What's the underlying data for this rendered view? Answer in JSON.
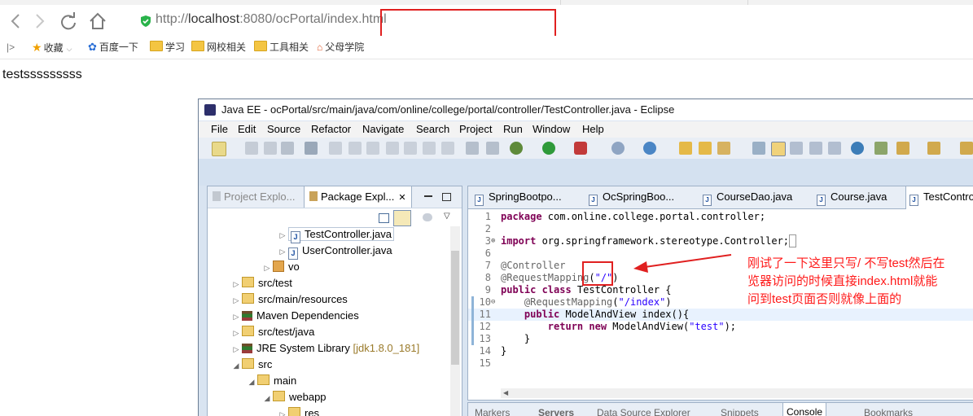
{
  "browser": {
    "url_scheme": "http://",
    "url_host": "localhost",
    "url_path": ":8080/ocPortal/index.html",
    "bookmarks": [
      {
        "label": "收藏",
        "icon": "star-icon"
      },
      {
        "label": "百度一下",
        "icon": "baidu-paw-icon"
      },
      {
        "label": "学习",
        "icon": "folder-icon"
      },
      {
        "label": "网校相关",
        "icon": "folder-icon"
      },
      {
        "label": "工具相关",
        "icon": "folder-icon"
      },
      {
        "label": "父母学院",
        "icon": "home-icon"
      }
    ]
  },
  "page": {
    "text": "testsssssssss"
  },
  "eclipse": {
    "title": "Java EE - ocPortal/src/main/java/com/online/college/portal/controller/TestController.java - Eclipse",
    "menu": [
      "File",
      "Edit",
      "Source",
      "Refactor",
      "Navigate",
      "Search",
      "Project",
      "Run",
      "Window",
      "Help"
    ],
    "left_tabs": [
      "Project Explo...",
      "Package Expl..."
    ],
    "tree": [
      {
        "label": "TestController.java",
        "type": "java",
        "selected": true
      },
      {
        "label": "UserController.java",
        "type": "java"
      },
      {
        "label": "vo",
        "type": "package"
      },
      {
        "label": "src/test",
        "type": "src-folder"
      },
      {
        "label": "src/main/resources",
        "type": "src-folder"
      },
      {
        "label": "Maven Dependencies",
        "type": "library"
      },
      {
        "label": "src/test/java",
        "type": "src-folder"
      },
      {
        "label": "JRE System Library",
        "type": "library",
        "suffix": "[jdk1.8.0_181]"
      },
      {
        "label": "src",
        "type": "folder"
      },
      {
        "label": "main",
        "type": "folder"
      },
      {
        "label": "webapp",
        "type": "folder"
      },
      {
        "label": "res",
        "type": "folder"
      }
    ],
    "editor_tabs": [
      "SpringBootpo...",
      "OcSpringBoo...",
      "CourseDao.java",
      "Course.java",
      "TestContro"
    ],
    "code": [
      {
        "n": "1",
        "text": "package com.online.college.portal.controller;"
      },
      {
        "n": "2",
        "text": ""
      },
      {
        "n": "3",
        "text": "import org.springframework.stereotype.Controller;"
      },
      {
        "n": "6",
        "text": ""
      },
      {
        "n": "7",
        "text": "@Controller"
      },
      {
        "n": "8",
        "text": "@RequestMapping(\"/\")"
      },
      {
        "n": "9",
        "text": "public class TestController {"
      },
      {
        "n": "10",
        "text": "    @RequestMapping(\"/index\")"
      },
      {
        "n": "11",
        "text": "    public ModelAndView index(){"
      },
      {
        "n": "12",
        "text": "        return new ModelAndView(\"test\");"
      },
      {
        "n": "13",
        "text": "    }"
      },
      {
        "n": "14",
        "text": "}"
      },
      {
        "n": "15",
        "text": ""
      }
    ],
    "bottom_tabs": [
      "Markers",
      "Servers",
      "Data Source Explorer",
      "Snippets",
      "Console",
      "Bookmarks"
    ]
  },
  "annotation": {
    "lines": [
      "刚试了一下这里只写/ 不写test然后在",
      "览器访问的时候直接index.html就能",
      "问到test页面否则就像上面的"
    ],
    "color": "#ff1a1a"
  }
}
